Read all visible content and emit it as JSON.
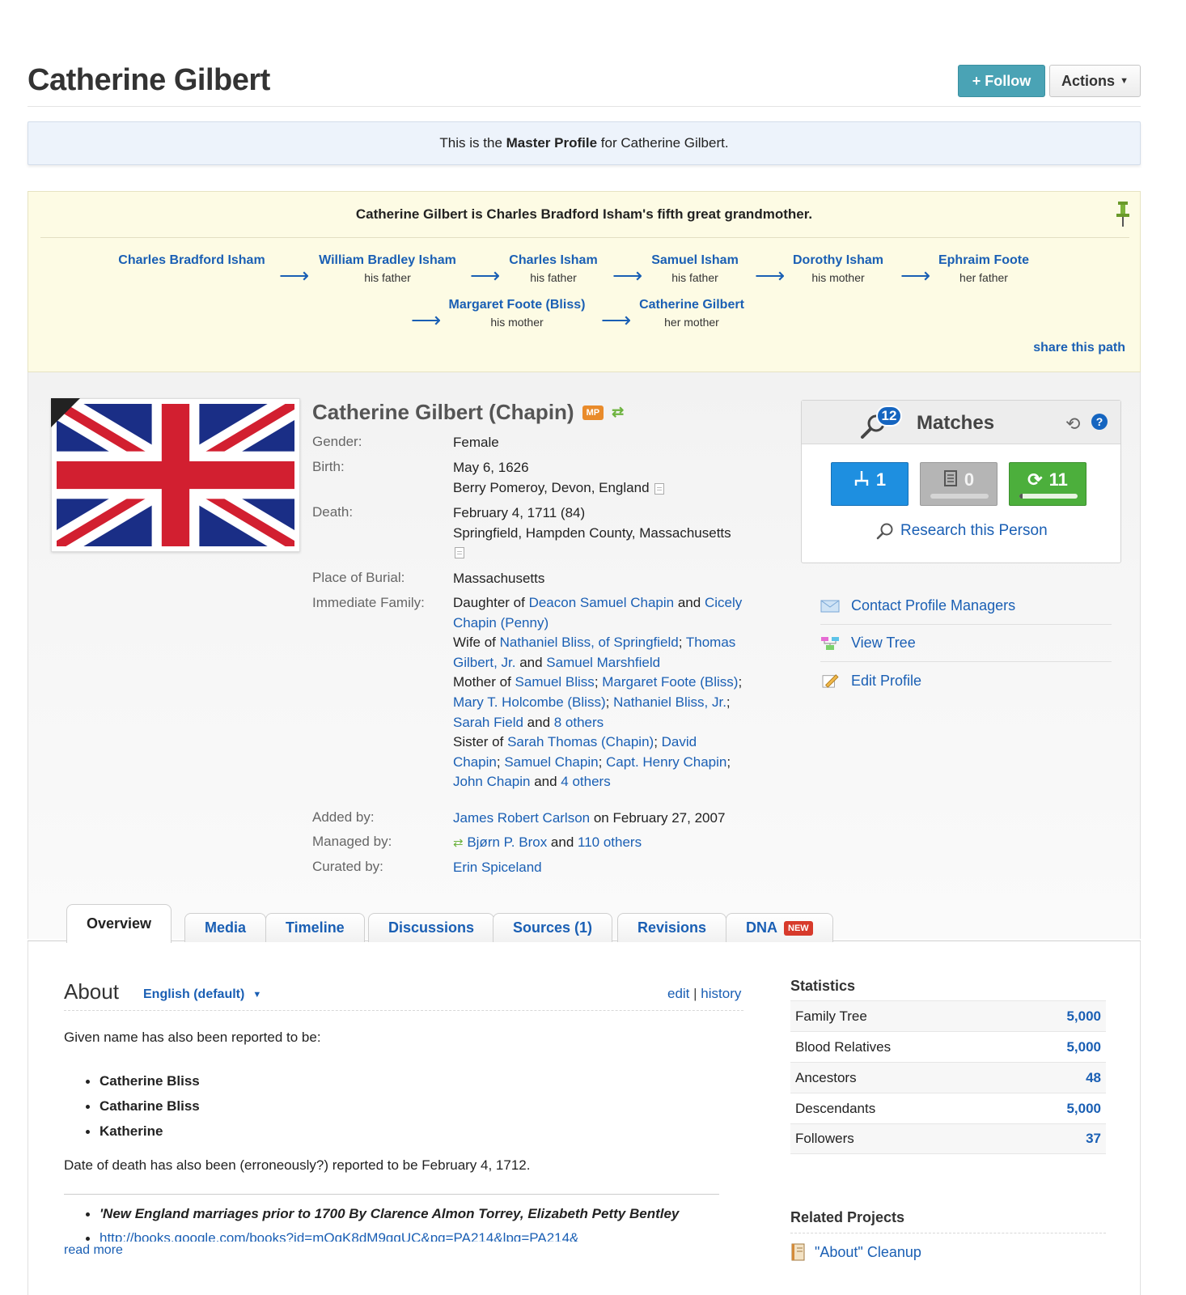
{
  "header": {
    "title": "Catherine Gilbert",
    "follow_label": "+ Follow",
    "actions_label": "Actions"
  },
  "master": {
    "prefix": "This is the ",
    "bold": "Master Profile",
    "suffix": " for Catherine Gilbert."
  },
  "path": {
    "title": "Catherine Gilbert is Charles Bradford Isham's fifth great grandmother.",
    "arrow": "⟶",
    "share_label": "share this path",
    "nodes": [
      {
        "name": "Charles Bradford Isham",
        "rel": ""
      },
      {
        "name": "William Bradley Isham",
        "rel": "his father"
      },
      {
        "name": "Charles Isham",
        "rel": "his father"
      },
      {
        "name": "Samuel Isham",
        "rel": "his father"
      },
      {
        "name": "Dorothy Isham",
        "rel": "his mother"
      },
      {
        "name": "Ephraim Foote",
        "rel": "her father"
      },
      {
        "name": "Margaret Foote (Bliss)",
        "rel": "his mother"
      },
      {
        "name": "Catherine Gilbert",
        "rel": "her mother"
      }
    ]
  },
  "profile": {
    "name": "Catherine Gilbert (Chapin)",
    "mp_badge": "MP",
    "sync_icon": "⇄",
    "labels": {
      "gender": "Gender:",
      "birth": "Birth:",
      "death": "Death:",
      "burial": "Place of Burial:",
      "family": "Immediate Family:",
      "added": "Added by:",
      "managed": "Managed by:",
      "curated": "Curated by:"
    },
    "gender": "Female",
    "birth_date": "May 6, 1626",
    "birth_place": "Berry Pomeroy, Devon, England",
    "death_date": "February 4, 1711 (84)",
    "death_place": "Springfield, Hampden County, Massachusetts",
    "burial": "Massachusetts",
    "family": {
      "daughter_of": "Daughter of ",
      "father": "Deacon Samuel Chapin",
      "and1": " and ",
      "mother_a": "Cicely",
      "mother_b": "Chapin (Penny)",
      "wife_of": "Wife of ",
      "h1": "Nathaniel Bliss, of Springfield",
      "sep": "; ",
      "h2a": "Thomas",
      "h2b": "Gilbert, Jr.",
      "and2": " and ",
      "h3": "Samuel Marshfield",
      "mother_of": "Mother of ",
      "c1": "Samuel Bliss",
      "c2": "Margaret Foote (Bliss)",
      "semi": ";",
      "c3": "Mary T. Holcombe (Bliss)",
      "c4": "Nathaniel Bliss, Jr.",
      "c5": "Sarah Field",
      "and3": " and ",
      "c_others": "8 others",
      "sister_of": "Sister of ",
      "s1": "Sarah Thomas (Chapin)",
      "s2a": "David",
      "s2b": "Chapin",
      "s3": "Samuel Chapin",
      "s4": "Capt. Henry Chapin",
      "s5": "John Chapin",
      "and4": " and ",
      "s_others": "4 others"
    },
    "added_by": "James Robert Carlson",
    "added_on": " on February 27, 2007",
    "managed_by": "Bjørn P. Brox",
    "managed_and": " and ",
    "managed_others": "110 others",
    "curated_by": "Erin Spiceland"
  },
  "matches": {
    "title": "Matches",
    "count": "12",
    "help": "?",
    "refresh_icon": "⟲",
    "tree_matches": "1",
    "record_matches": "0",
    "smart_matches": "11",
    "smart_progress": 0.05,
    "research_label": "Research this Person",
    "colors": {
      "tree": "#1e8fe0",
      "record": "#b5b5b5",
      "smart": "#4caf3c"
    }
  },
  "side_links": [
    {
      "label": "Contact Profile Managers",
      "icon": "envelope-icon"
    },
    {
      "label": "View Tree",
      "icon": "tree-icon"
    },
    {
      "label": "Edit Profile",
      "icon": "pencil-icon"
    }
  ],
  "tabs": [
    {
      "label": "Overview",
      "active": true
    },
    {
      "label": "Media"
    },
    {
      "label": "Timeline"
    },
    {
      "label": "Discussions"
    },
    {
      "label": "Sources (1)"
    },
    {
      "label": "Revisions"
    },
    {
      "label": "DNA",
      "badge": "NEW"
    }
  ],
  "about": {
    "title": "About",
    "language": "English (default)",
    "edit": "edit",
    "divider": " | ",
    "history": "history",
    "intro": "Given name has also been reported to be:",
    "names": [
      "Catherine Bliss",
      "Catharine Bliss",
      "Katherine"
    ],
    "death_note": "Date of death has also been (erroneously?) reported to be February 4, 1712.",
    "source1": "'New England marriages prior to 1700 By Clarence Almon Torrey, Elizabeth Petty Bentley",
    "source2": "http://books.google.com/books?id=mOqK8dM9qqUC&pg=PA214&lpg=PA214&",
    "read_more": "read more"
  },
  "statistics": {
    "title": "Statistics",
    "rows": [
      {
        "label": "Family Tree",
        "value": "5,000"
      },
      {
        "label": "Blood Relatives",
        "value": "5,000"
      },
      {
        "label": "Ancestors",
        "value": "48"
      },
      {
        "label": "Descendants",
        "value": "5,000"
      },
      {
        "label": "Followers",
        "value": "37"
      }
    ]
  },
  "related": {
    "title": "Related Projects",
    "items": [
      "\"About\" Cleanup"
    ]
  }
}
